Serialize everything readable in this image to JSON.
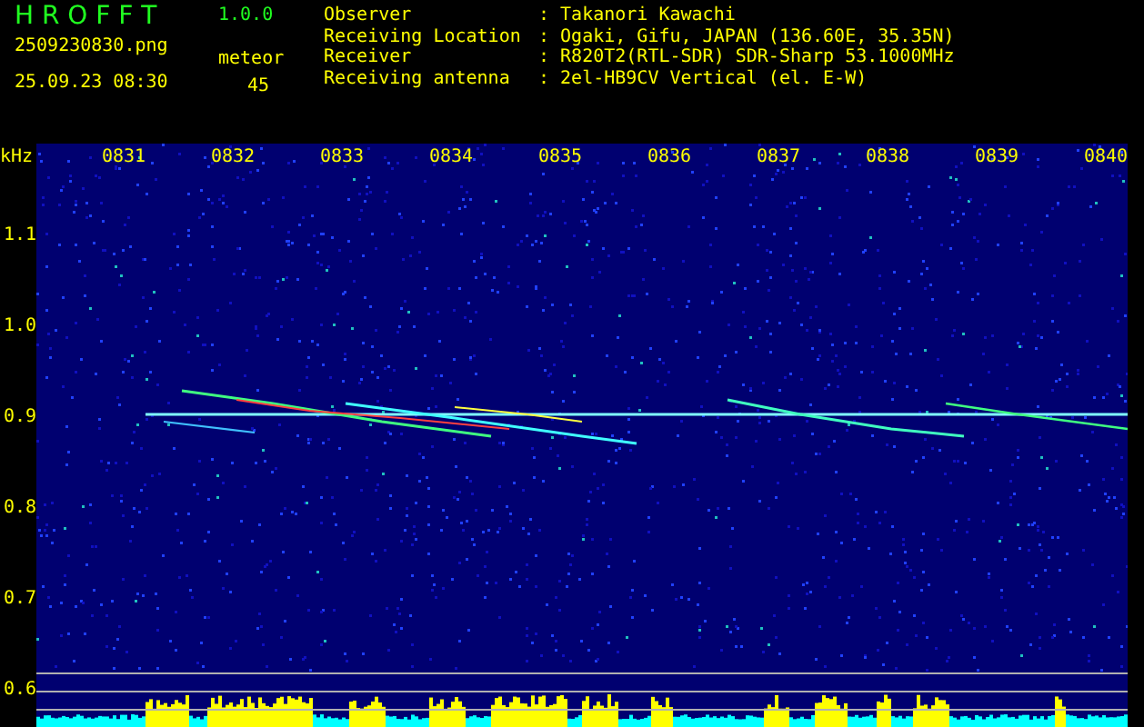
{
  "app": {
    "name": "H R O F F T",
    "version": "1.0.0"
  },
  "file": {
    "name": "2509230830.png",
    "datetime": "25.09.23 08:30"
  },
  "meteor": {
    "label": "meteor",
    "count": "45"
  },
  "info": [
    {
      "label": "Observer",
      "value": ": Takanori Kawachi"
    },
    {
      "label": "Receiving Location",
      "value": ": Ogaki, Gifu, JAPAN (136.60E, 35.35N)"
    },
    {
      "label": "Receiver",
      "value": ": R820T2(RTL-SDR) SDR-Sharp 53.1000MHz"
    },
    {
      "label": "Receiving antenna",
      "value": ": 2el-HB9CV Vertical (el. E-W)"
    }
  ],
  "spectrogram": {
    "unit": "kHz",
    "time_labels": [
      "0831",
      "0832",
      "0833",
      "0834",
      "0835",
      "0836",
      "0837",
      "0838",
      "0839",
      "0840"
    ],
    "freq_labels": [
      "1.1",
      "1.0",
      "0.9",
      "0.8",
      "0.7",
      "0.6"
    ]
  }
}
